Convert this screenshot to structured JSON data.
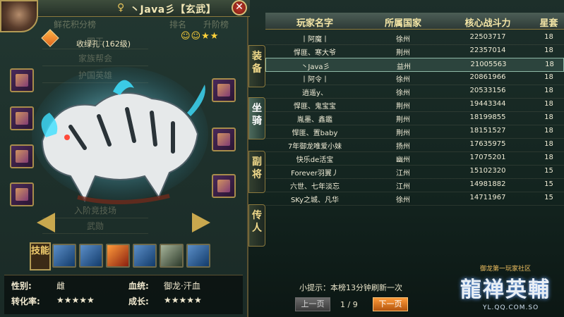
{
  "window": {
    "title": "丶Java彡【玄武】",
    "title_emblem": "♀"
  },
  "mount": {
    "level_label": "收绿孔 (162级)",
    "stars": "☺☺★★"
  },
  "ghost_list": [
    "国王",
    "家族帮会",
    "护国英雄",
    "入阶竞技场",
    "武勋"
  ],
  "ghost_header": [
    "鲜花积分榜",
    "排名",
    "升阶榜"
  ],
  "skills": {
    "label": "技能"
  },
  "stats": {
    "gender_label": "性别:",
    "gender_value": "雌",
    "bloodline_label": "血统:",
    "bloodline_value": "御龙·汗血",
    "conversion_label": "转化率:",
    "conversion_value": "★★★★★",
    "growth_label": "成长:",
    "growth_value": "★★★★★"
  },
  "side_tabs": [
    "装备",
    "坐骑",
    "副将",
    "传人"
  ],
  "table": {
    "headers": [
      "玩家名字",
      "所属国家",
      "核心战斗力",
      "星套"
    ],
    "rows": [
      {
        "name": "丨阿魔丨",
        "country": "徐州",
        "power": "22503717",
        "star": "18"
      },
      {
        "name": "悍匪、寒大爷",
        "country": "荆州",
        "power": "22357014",
        "star": "18"
      },
      {
        "name": "丶Java彡",
        "country": "益州",
        "power": "21005563",
        "star": "18"
      },
      {
        "name": "丨阿令丨",
        "country": "徐州",
        "power": "20861966",
        "star": "18"
      },
      {
        "name": "逍遥y、",
        "country": "徐州",
        "power": "20533156",
        "star": "18"
      },
      {
        "name": "悍匪、鬼宝宝",
        "country": "荆州",
        "power": "19443344",
        "star": "18"
      },
      {
        "name": "胤墨、鑫鑑",
        "country": "荆州",
        "power": "18199855",
        "star": "18"
      },
      {
        "name": "悍匪、置baby",
        "country": "荆州",
        "power": "18151527",
        "star": "18"
      },
      {
        "name": "7年御龙唯爱小妹",
        "country": "扬州",
        "power": "17635975",
        "star": "18"
      },
      {
        "name": "快乐de活宝",
        "country": "幽州",
        "power": "17075201",
        "star": "18"
      },
      {
        "name": "Forever羽翼丿",
        "country": "江州",
        "power": "15102320",
        "star": "15"
      },
      {
        "name": "六世、七年淡忘",
        "country": "江州",
        "power": "14981882",
        "star": "15"
      },
      {
        "name": "SKy之城、凡华",
        "country": "徐州",
        "power": "14711967",
        "star": "15"
      }
    ],
    "selected_index": 2
  },
  "footer": {
    "tip": "小提示：本榜13分钟刷新一次",
    "prev_label": "上一页",
    "next_label": "下一页",
    "page_indicator": "1 / 9"
  },
  "logo": {
    "tagline": "御龙第一玩家社区",
    "main": "龍禅英輔",
    "url": "YL.QQ.COM.SO"
  }
}
